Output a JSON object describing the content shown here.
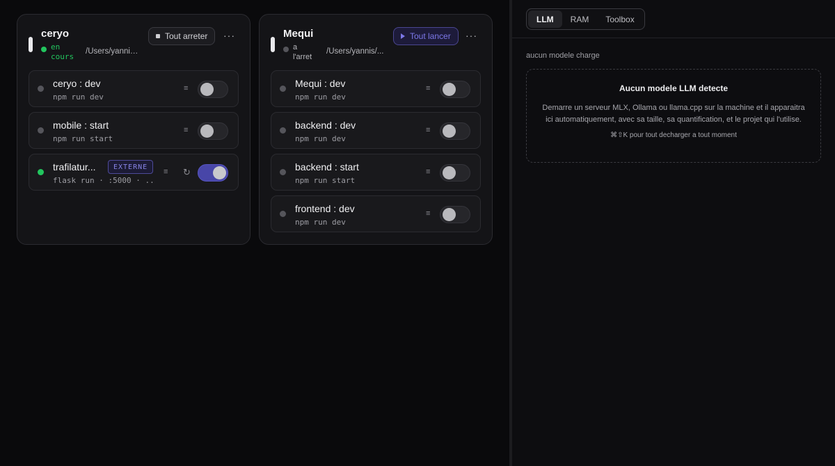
{
  "projects": [
    {
      "name": "ceryo",
      "status": "en cours",
      "status_color": "#22c55e",
      "path": "/Users/yannis/...",
      "action_label": "Tout arreter",
      "more": "···",
      "processes": [
        {
          "name": "ceryo : dev",
          "cmd": "npm run dev",
          "running": false
        },
        {
          "name": "mobile : start",
          "cmd": "npm run start",
          "running": false
        },
        {
          "name": "trafilatur...",
          "cmd": "flask run · :5000 · ...",
          "running": true,
          "badge": "EXTERNE"
        }
      ]
    },
    {
      "name": "Mequi",
      "status": "a l'arret",
      "status_color": "#55555b",
      "path": "/Users/yannis/...",
      "action_label": "Tout lancer",
      "more": "···",
      "processes": [
        {
          "name": "Mequi : dev",
          "cmd": "npm run dev",
          "running": false
        },
        {
          "name": "backend : dev",
          "cmd": "npm run dev",
          "running": false
        },
        {
          "name": "backend : start",
          "cmd": "npm run start",
          "running": false
        },
        {
          "name": "frontend : dev",
          "cmd": "npm run dev",
          "running": false
        }
      ]
    }
  ],
  "icons": {
    "menu": "≡",
    "restart": "↻"
  },
  "panel": {
    "tabs": [
      {
        "label": "LLM",
        "active": true
      },
      {
        "label": "RAM",
        "active": false
      },
      {
        "label": "Toolbox",
        "active": false
      }
    ],
    "status_text": "aucun modele charge",
    "empty_title": "Aucun modele LLM detecte",
    "empty_desc": "Demarre un serveur MLX, Ollama ou llama.cpp sur la machine et il apparaitra ici automatiquement, avec sa taille, sa quantification, et le projet qui l'utilise.",
    "empty_hint": "⌘⇧K pour tout decharger a tout moment"
  },
  "colors": {
    "accent": "#4846a8",
    "running": "#22c55e",
    "idle": "#55555b"
  }
}
